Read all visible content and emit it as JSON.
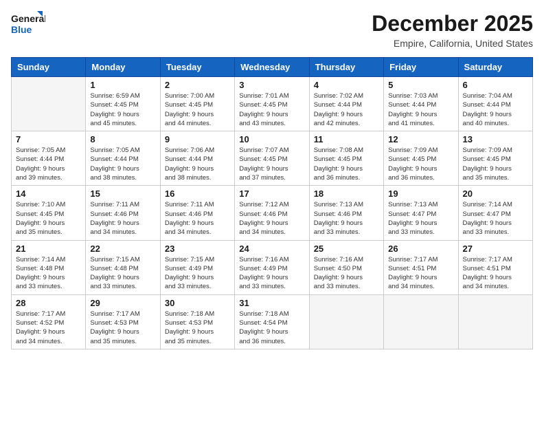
{
  "header": {
    "logo_line1": "General",
    "logo_line2": "Blue",
    "month": "December 2025",
    "location": "Empire, California, United States"
  },
  "weekdays": [
    "Sunday",
    "Monday",
    "Tuesday",
    "Wednesday",
    "Thursday",
    "Friday",
    "Saturday"
  ],
  "weeks": [
    [
      {
        "num": "",
        "info": ""
      },
      {
        "num": "1",
        "info": "Sunrise: 6:59 AM\nSunset: 4:45 PM\nDaylight: 9 hours\nand 45 minutes."
      },
      {
        "num": "2",
        "info": "Sunrise: 7:00 AM\nSunset: 4:45 PM\nDaylight: 9 hours\nand 44 minutes."
      },
      {
        "num": "3",
        "info": "Sunrise: 7:01 AM\nSunset: 4:45 PM\nDaylight: 9 hours\nand 43 minutes."
      },
      {
        "num": "4",
        "info": "Sunrise: 7:02 AM\nSunset: 4:44 PM\nDaylight: 9 hours\nand 42 minutes."
      },
      {
        "num": "5",
        "info": "Sunrise: 7:03 AM\nSunset: 4:44 PM\nDaylight: 9 hours\nand 41 minutes."
      },
      {
        "num": "6",
        "info": "Sunrise: 7:04 AM\nSunset: 4:44 PM\nDaylight: 9 hours\nand 40 minutes."
      }
    ],
    [
      {
        "num": "7",
        "info": "Sunrise: 7:05 AM\nSunset: 4:44 PM\nDaylight: 9 hours\nand 39 minutes."
      },
      {
        "num": "8",
        "info": "Sunrise: 7:05 AM\nSunset: 4:44 PM\nDaylight: 9 hours\nand 38 minutes."
      },
      {
        "num": "9",
        "info": "Sunrise: 7:06 AM\nSunset: 4:44 PM\nDaylight: 9 hours\nand 38 minutes."
      },
      {
        "num": "10",
        "info": "Sunrise: 7:07 AM\nSunset: 4:45 PM\nDaylight: 9 hours\nand 37 minutes."
      },
      {
        "num": "11",
        "info": "Sunrise: 7:08 AM\nSunset: 4:45 PM\nDaylight: 9 hours\nand 36 minutes."
      },
      {
        "num": "12",
        "info": "Sunrise: 7:09 AM\nSunset: 4:45 PM\nDaylight: 9 hours\nand 36 minutes."
      },
      {
        "num": "13",
        "info": "Sunrise: 7:09 AM\nSunset: 4:45 PM\nDaylight: 9 hours\nand 35 minutes."
      }
    ],
    [
      {
        "num": "14",
        "info": "Sunrise: 7:10 AM\nSunset: 4:45 PM\nDaylight: 9 hours\nand 35 minutes."
      },
      {
        "num": "15",
        "info": "Sunrise: 7:11 AM\nSunset: 4:46 PM\nDaylight: 9 hours\nand 34 minutes."
      },
      {
        "num": "16",
        "info": "Sunrise: 7:11 AM\nSunset: 4:46 PM\nDaylight: 9 hours\nand 34 minutes."
      },
      {
        "num": "17",
        "info": "Sunrise: 7:12 AM\nSunset: 4:46 PM\nDaylight: 9 hours\nand 34 minutes."
      },
      {
        "num": "18",
        "info": "Sunrise: 7:13 AM\nSunset: 4:46 PM\nDaylight: 9 hours\nand 33 minutes."
      },
      {
        "num": "19",
        "info": "Sunrise: 7:13 AM\nSunset: 4:47 PM\nDaylight: 9 hours\nand 33 minutes."
      },
      {
        "num": "20",
        "info": "Sunrise: 7:14 AM\nSunset: 4:47 PM\nDaylight: 9 hours\nand 33 minutes."
      }
    ],
    [
      {
        "num": "21",
        "info": "Sunrise: 7:14 AM\nSunset: 4:48 PM\nDaylight: 9 hours\nand 33 minutes."
      },
      {
        "num": "22",
        "info": "Sunrise: 7:15 AM\nSunset: 4:48 PM\nDaylight: 9 hours\nand 33 minutes."
      },
      {
        "num": "23",
        "info": "Sunrise: 7:15 AM\nSunset: 4:49 PM\nDaylight: 9 hours\nand 33 minutes."
      },
      {
        "num": "24",
        "info": "Sunrise: 7:16 AM\nSunset: 4:49 PM\nDaylight: 9 hours\nand 33 minutes."
      },
      {
        "num": "25",
        "info": "Sunrise: 7:16 AM\nSunset: 4:50 PM\nDaylight: 9 hours\nand 33 minutes."
      },
      {
        "num": "26",
        "info": "Sunrise: 7:17 AM\nSunset: 4:51 PM\nDaylight: 9 hours\nand 34 minutes."
      },
      {
        "num": "27",
        "info": "Sunrise: 7:17 AM\nSunset: 4:51 PM\nDaylight: 9 hours\nand 34 minutes."
      }
    ],
    [
      {
        "num": "28",
        "info": "Sunrise: 7:17 AM\nSunset: 4:52 PM\nDaylight: 9 hours\nand 34 minutes."
      },
      {
        "num": "29",
        "info": "Sunrise: 7:17 AM\nSunset: 4:53 PM\nDaylight: 9 hours\nand 35 minutes."
      },
      {
        "num": "30",
        "info": "Sunrise: 7:18 AM\nSunset: 4:53 PM\nDaylight: 9 hours\nand 35 minutes."
      },
      {
        "num": "31",
        "info": "Sunrise: 7:18 AM\nSunset: 4:54 PM\nDaylight: 9 hours\nand 36 minutes."
      },
      {
        "num": "",
        "info": ""
      },
      {
        "num": "",
        "info": ""
      },
      {
        "num": "",
        "info": ""
      }
    ]
  ]
}
